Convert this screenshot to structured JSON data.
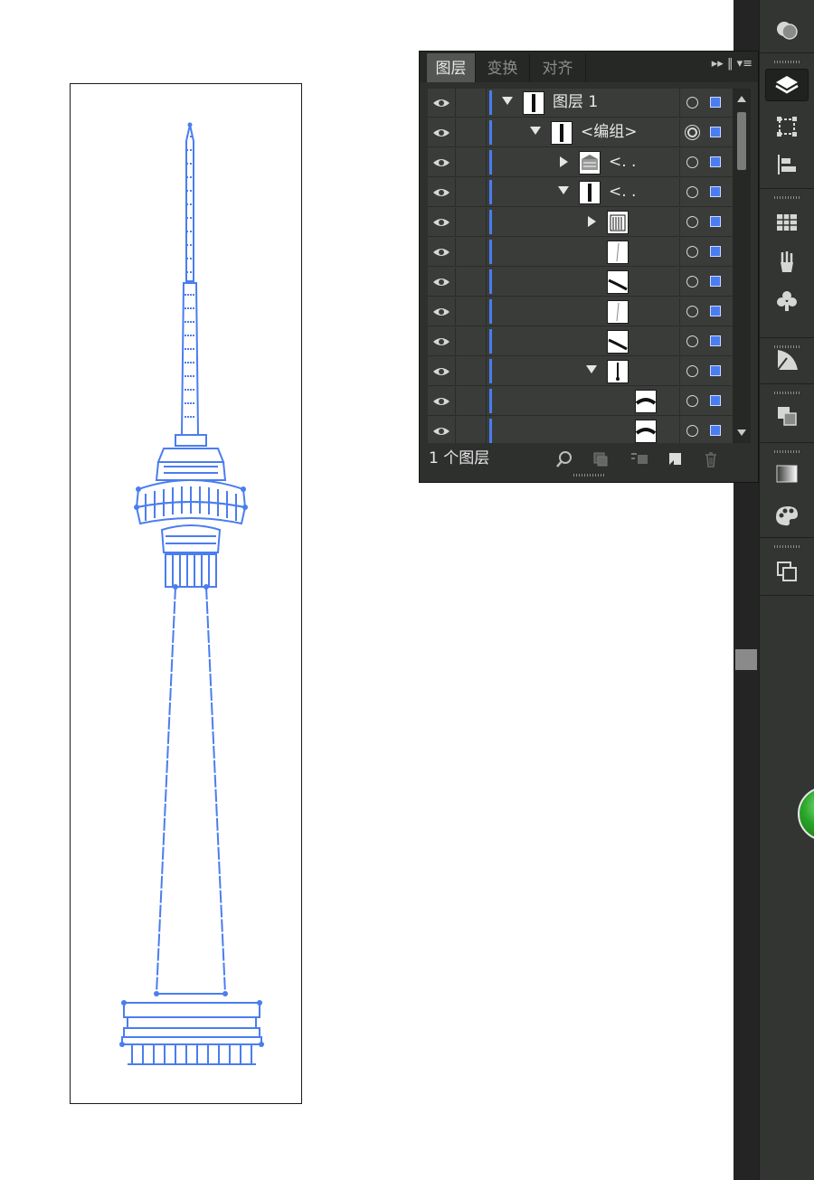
{
  "panel": {
    "tabs": [
      "图层",
      "变换",
      "对齐"
    ],
    "active_tab": 0,
    "footer_count": "1 个图层",
    "layers": [
      {
        "name": "图层 1",
        "expanded": true,
        "has_arrow": true,
        "level": 0,
        "thumb": "tower"
      },
      {
        "name": "<编组>",
        "expanded": true,
        "has_arrow": true,
        "level": 1,
        "thumb": "tower",
        "target": "double"
      },
      {
        "name": "<. .",
        "expanded": false,
        "has_arrow": true,
        "level": 2,
        "thumb": "building"
      },
      {
        "name": "<. .",
        "expanded": true,
        "has_arrow": true,
        "level": 2,
        "thumb": "tower"
      },
      {
        "name": "",
        "expanded": false,
        "has_arrow": true,
        "level": 3,
        "thumb": "columns"
      },
      {
        "name": "",
        "has_arrow": false,
        "level": 3,
        "thumb": "line"
      },
      {
        "name": "",
        "has_arrow": false,
        "level": 3,
        "thumb": "curve"
      },
      {
        "name": "",
        "has_arrow": false,
        "level": 3,
        "thumb": "line"
      },
      {
        "name": "",
        "has_arrow": false,
        "level": 3,
        "thumb": "curve"
      },
      {
        "name": "",
        "expanded": true,
        "has_arrow": true,
        "level": 3,
        "thumb": "needle"
      },
      {
        "name": "",
        "has_arrow": false,
        "level": 4,
        "thumb": "arc"
      },
      {
        "name": "",
        "has_arrow": false,
        "level": 4,
        "thumb": "arc"
      }
    ]
  },
  "dock": {
    "tools": [
      "appearance-icon",
      "layers-icon",
      "transform-icon",
      "align-icon",
      "swatches-icon",
      "brushes-icon",
      "symbols-icon",
      "stroke-icon",
      "pathfinder-icon",
      "gradient-icon",
      "color-guide-icon",
      "artboards-icon"
    ],
    "active": "layers-icon"
  },
  "colors": {
    "accent": "#4a7df0",
    "panel_bg": "#2e302e",
    "dock_bg": "#323532"
  }
}
